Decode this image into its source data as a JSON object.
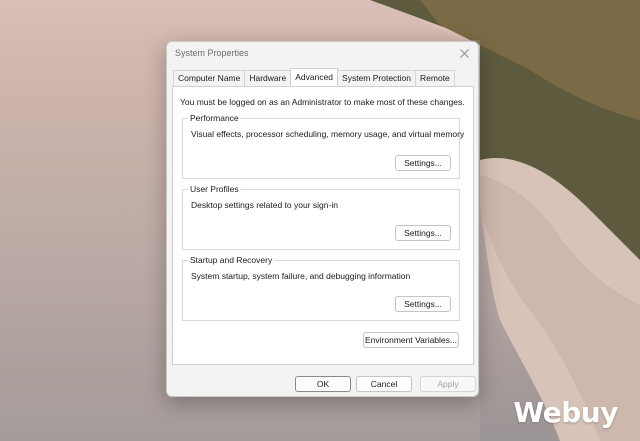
{
  "dialog": {
    "title": "System Properties",
    "tabs": [
      {
        "label": "Computer Name"
      },
      {
        "label": "Hardware"
      },
      {
        "label": "Advanced"
      },
      {
        "label": "System Protection"
      },
      {
        "label": "Remote"
      }
    ],
    "active_tab": "Advanced",
    "admin_note": "You must be logged on as an Administrator to make most of these changes.",
    "groups": [
      {
        "label": "Performance",
        "description": "Visual effects, processor scheduling, memory usage, and virtual memory",
        "button": "Settings..."
      },
      {
        "label": "User Profiles",
        "description": "Desktop settings related to your sign-in",
        "button": "Settings..."
      },
      {
        "label": "Startup and Recovery",
        "description": "System startup, system failure, and debugging information",
        "button": "Settings..."
      }
    ],
    "env_button": "Environment Variables...",
    "footer": {
      "ok": "OK",
      "cancel": "Cancel",
      "apply": "Apply"
    }
  },
  "watermark": "Webuy",
  "colors": {
    "dialog_bg": "#f3f3f3",
    "panel_bg": "#ffffff",
    "disabled_text": "#a3a3a3"
  }
}
